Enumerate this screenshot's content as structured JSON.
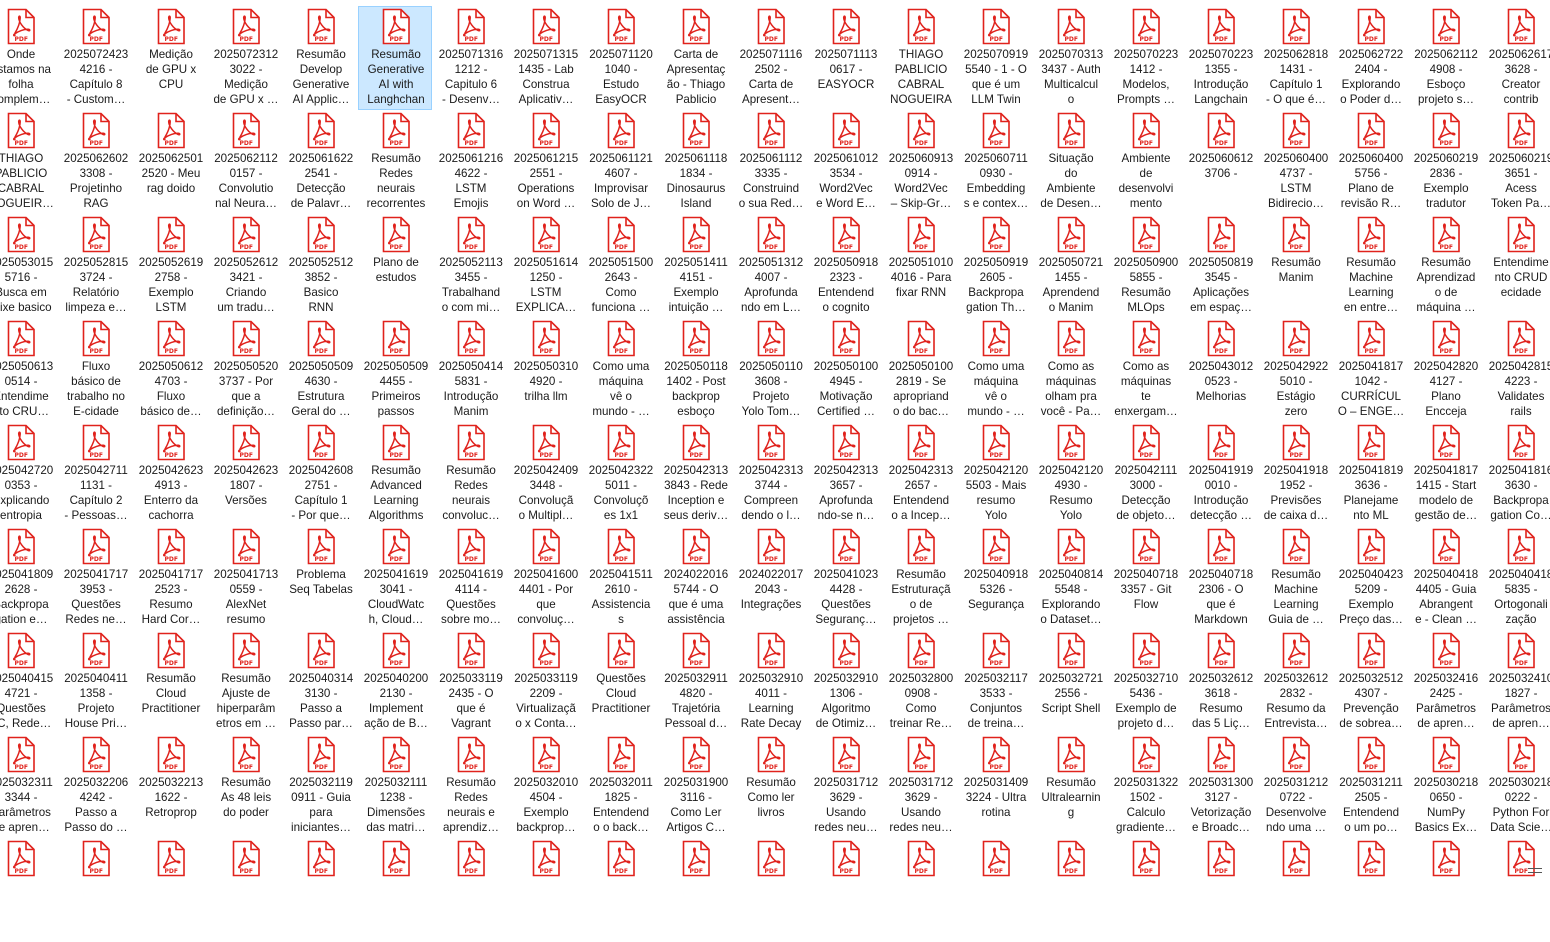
{
  "window": {
    "view": "Large icons",
    "selected_index": 5
  },
  "icon": {
    "type": "pdf",
    "badge_text": "PDF",
    "color": "#e0221c"
  },
  "files": [
    [
      "Onde\nestamos na\nfolha\ncomplem…",
      "2025072423\n4216 -\nCapítulo 8\n- Custom…",
      "Medição\nde GPU x\nCPU",
      "2025072312\n3022 -\nMedição\nde GPU x …",
      "Resumão\nDevelop\nGenerative\nAI Applic…",
      "Resumão\nGenerative\nAI with\nLanghchan",
      "2025071316\n1212 -\nCapitulo 6\n- Desenv…",
      "2025071315\n1435 - Lab\nConstrua\nAplicativ…",
      "2025071120\n1040 -\nEstudo\nEasyOCR",
      "Carta de\nApresentaç\não - Thiago\nPablicio",
      "2025071116\n2502 -\nCarta de\nApresent…",
      "2025071113\n0617 -\nEASYOCR",
      "THIAGO\nPABLICIO\nCABRAL\nNOGUEIRA",
      "2025070919\n5540 - 1 - O\nque é um\nLLM Twin",
      "2025070313\n3437 - Auth\nMulticalcul\no",
      "2025070223\n1412 -\nModelos,\nPrompts …",
      "2025070223\n1355 -\nIntrodução\nLangchain",
      "2025062818\n1431 -\nCapítulo 1\n- O que é…",
      "2025062722\n2404 -\nExplorando\no Poder d…",
      "2025062112\n4908 -\nEsboço\nprojeto s…",
      "2025062617\n3628 -\nCreator\ncontrib"
    ],
    [
      "THIAGO\nPABLICIO\nCABRAL\nNOGUEIR…",
      "2025062602\n3308 -\nProjetinho\nRAG",
      "2025062501\n2520 - Meu\nrag doido",
      "2025062112\n0157 -\nConvolutio\nnal Neura…",
      "2025061622\n2541 -\nDetecção\nde Palavr…",
      "Resumão\nRedes\nneurais\nrecorrentes",
      "2025061216\n4622 -\nLSTM\nEmojis",
      "2025061215\n2551 -\nOperations\non Word …",
      "2025061121\n4607 -\nImprovisar\nSolo de J…",
      "2025061118\n1834 -\nDinosaurus\nIsland",
      "2025061112\n3335 -\nConstruind\no sua Red…",
      "2025061012\n3534 -\nWord2Vec\ne Word E…",
      "2025060913\n0914 -\nWord2Vec\n– Skip-Gr…",
      "2025060711\n0930 -\nEmbedding\ns e contex…",
      "Situação\ndo\nAmbiente\nde Desen…",
      "Ambiente\nde\ndesenvolvi\nmento",
      "2025060612\n3706 -",
      "2025060400\n4737 -\nLSTM\nBidirecio…",
      "2025060400\n5756 -\nPlano de\nrevisão R…",
      "2025060219\n2836 -\nExemplo\ntradutor",
      "2025060219\n3651 -\nAcess\nToken Pa…"
    ],
    [
      "2025053015\n5716 -\nBusca em\nfeixe basico",
      "2025052815\n3724 -\nRelatório\nlimpeza e…",
      "2025052619\n2758 -\nExemplo\nLSTM",
      "2025052612\n3421 -\nCriando\num tradu…",
      "2025052512\n3852 -\nBasico\nRNN",
      "Plano de\nestudos",
      "2025052113\n3455 -\nTrabalhand\no com mi…",
      "2025051614\n1250 -\nLSTM\nEXPLICA…",
      "2025051500\n2643 -\nComo\nfunciona …",
      "2025051411\n4151 -\nExemplo\nintuição …",
      "2025051312\n4007 -\nAprofunda\nndo em L…",
      "2025050918\n2323 -\nEntendend\no cognito",
      "2025051010\n4016 - Para\nfixar RNN",
      "2025050919\n2605 -\nBackpropa\ngation Th…",
      "2025050721\n1455 -\nAprendend\no Manim",
      "2025050900\n5855 -\nResumão\nMLOps",
      "2025050819\n3545 -\nAplicações\nem espaç…",
      "Resumão\nManim",
      "Resumão\nMachine\nLearning\nen entre…",
      "Resumão\nAprendizad\no de\nmáquina …",
      "Entendime\nnto CRUD\necidade"
    ],
    [
      "2025050613\n0514 -\nEntendime\nnto CRU…",
      "Fluxo\nbásico de\ntrabalho no\nE-cidade",
      "2025050612\n4703 -\nFluxo\nbásico de…",
      "2025050520\n3737 - Por\nque a\ndefinição…",
      "2025050509\n4630 -\nEstrutura\nGeral do …",
      "2025050509\n4455 -\nPrimeiros\npassos",
      "2025050414\n5831 -\nIntrodução\nManim",
      "2025050310\n4920 -\ntrilha llm",
      "Como uma\nmáquina\nvê o\nmundo - …",
      "2025050118\n1402 - Post\nbackprop\nesboço",
      "2025050110\n3608 -\nProjeto\nYolo Tom…",
      "2025050100\n4945 -\nMotivação\nCertified …",
      "2025050100\n2819 - Se\napropriand\no do bac…",
      "Como uma\nmáquina\nvê o\nmundo - …",
      "Como as\nmáquinas\nolham pra\nvocê - Pa…",
      "Como as\nmáquinas\nte\nenxergam…",
      "2025043012\n0523 -\nMelhorias",
      "2025042922\n5010 -\nEstágio\nzero",
      "2025041817\n1042 -\nCURRÍCUL\nO – ENGE…",
      "2025042820\n4127 -\nPlano\nEncceja",
      "2025042815\n4223 -\nValidates\nrails"
    ],
    [
      "2025042720\n0353 -\nExplicando\nentropia",
      "2025042711\n1131 -\nCapítulo 2\n- Pessoas…",
      "2025042623\n4913 -\nEnterro da\ncachorra",
      "2025042623\n1807 -\nVersões",
      "2025042608\n2751 -\nCapítulo 1\n- Por que…",
      "Resumão\nAdvanced\nLearning\nAlgorithms",
      "Resumão\nRedes\nneurais\nconvoluc…",
      "2025042409\n3448 -\nConvoluçã\no Multipl…",
      "2025042322\n5011 -\nConvoluçõ\nes 1x1",
      "2025042313\n3843 - Rede\nInception e\nseus deriv…",
      "2025042313\n3744 -\nCompreen\ndendo o l…",
      "2025042313\n3657 -\nAprofunda\nndo-se n…",
      "2025042313\n2657 -\nEntendend\no a Incep…",
      "2025042120\n5503 - Mais\nresumo\nYolo",
      "2025042120\n4930 -\nResumo\nYolo",
      "2025042111\n3000 -\nDetecção\nde objeto…",
      "2025041919\n0010 -\nIntrodução\ndetecção …",
      "2025041918\n1952 -\nPrevisões\nde caixa d…",
      "2025041819\n3636 -\nPlanejame\nnto ML",
      "2025041817\n1415 - Start\nmodelo de\ngestão de…",
      "2025041816\n3630 -\nBackpropa\ngation Co…"
    ],
    [
      "2025041809\n2628 -\nBackpropa\ngation e…",
      "2025041717\n3953 -\nQuestões\nRedes ne…",
      "2025041717\n2523 -\nResumo\nHard Cor…",
      "2025041713\n0559 -\nAlexNet\nresumo",
      "Problema\nSeq Tabelas",
      "2025041619\n3041 -\nCloudWatc\nh, Cloud…",
      "2025041619\n4114 -\nQuestões\nsobre mo…",
      "2025041600\n4401 - Por\nque\nconvoluç…",
      "2025041511\n2610 -\nAssistencia\ns",
      "2024022016\n5744 - O\nque é uma\nassistência",
      "2024022017\n2043 -\nIntegrações",
      "2025041023\n4428 -\nQuestões\nSeguranç…",
      "Resumão\nEstruturaçã\no de\nprojetos …",
      "2025040918\n5326 -\nSegurança",
      "2025040814\n5548 -\nExplorando\no Dataset…",
      "2025040718\n3357 - Git\nFlow",
      "2025040718\n2306 - O\nque é\nMarkdown",
      "Resumão\nMachine\nLearning\nGuia de …",
      "2025040423\n5209 -\nExemplo\nPreço das…",
      "2025040418\n4405 - Guia\nAbrangent\ne - Clean …",
      "2025040418\n5835 -\nOrtogonali\nzação"
    ],
    [
      "2025040415\n4721 -\nQuestões\nLC, Rede…",
      "2025040411\n1358 -\nProjeto\nHouse Pri…",
      "Resumão\nCloud\nPractitioner",
      "Resumão\nAjuste de\nhiperparâm\netros em …",
      "2025040314\n3130 -\nPasso a\nPasso par…",
      "2025040200\n2130 -\nImplement\nação de B…",
      "2025033119\n2435 - O\nque é\nVagrant",
      "2025033119\n2209 -\nVirtualizaçã\no x Conta…",
      "Questões\nCloud\nPractitioner",
      "2025032911\n4820 -\nTrajetória\nPessoal d…",
      "2025032910\n4011 -\nLearning\nRate Decay",
      "2025032910\n1306 -\nAlgoritmo\nde Otimiz…",
      "2025032800\n0908 -\nComo\ntreinar Re…",
      "2025032117\n3533 -\nConjuntos\nde treina…",
      "2025032721\n2556 -\nScript Shell",
      "2025032710\n5436 -\nExemplo de\nprojeto d…",
      "2025032612\n3618 -\nResumo\ndas 5 Liç…",
      "2025032612\n2832 -\nResumo da\nEntrevista…",
      "2025032512\n4307 -\nPrevenção\nde sobrea…",
      "2025032416\n2425 -\nParâmetros\nde apren…",
      "2025032410\n1827 -\nParâmetros\nde apren…"
    ],
    [
      "2025032311\n3344 -\nParâmetros\nde apren…",
      "2025032206\n4242 -\nPasso a\nPasso do …",
      "2025032213\n1622 -\nRetroprop",
      "Resumão\nAs 48 leis\ndo poder",
      "2025032119\n0911 - Guia\npara\niniciantes…",
      "2025032111\n1238 -\nDimensões\ndas matri…",
      "Resumão\nRedes\nneurais e\naprendiz…",
      "2025032010\n4504 -\nExemplo\nbackprop…",
      "2025032011\n1825 -\nEntendend\no o back…",
      "2025031900\n3116 -\nComo Ler\nArtigos C…",
      "Resumão\nComo ler\nlivros",
      "2025031712\n3629 -\nUsando\nredes neu…",
      "2025031712\n3629 -\nUsando\nredes neu…",
      "2025031409\n3224 - Ultra\nrotina",
      "Resumão\nUltralearnin\ng",
      "2025031322\n1502 -\nCalculo\ngradiente…",
      "2025031300\n3127 -\nVetorização\ne Broadc…",
      "2025031212\n0722 -\nDesenvolve\nndo uma …",
      "2025031211\n2505 -\nEntendend\no um po…",
      "2025030218\n0650 -\nNumPy\nBasics Ex…",
      "2025030218\n0222 -\nPython For\nData Scie…"
    ],
    [
      "",
      "",
      "",
      "",
      "",
      "",
      "",
      "",
      "",
      "",
      "",
      "",
      "",
      "",
      "",
      "",
      "",
      "",
      "",
      "",
      ""
    ]
  ]
}
